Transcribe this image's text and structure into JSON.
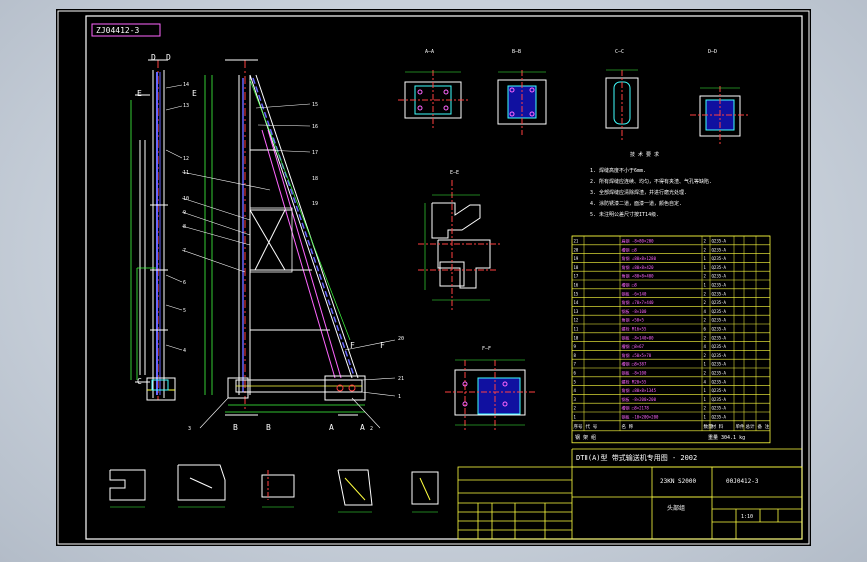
{
  "stamp_code": "ZJ04412-3",
  "colors": {
    "background": "#000000",
    "viewport": "#c9d1db",
    "outline": "#ffffff",
    "centerline": "#ff4040",
    "dimension": "#40ff40",
    "hidden": "#6666ff",
    "highlight": "#ff66ff",
    "table": "#ffff40",
    "cyan": "#40ffff"
  },
  "leader_labels": [
    "14",
    "13",
    "12",
    "11",
    "10",
    "9",
    "8",
    "7",
    "6",
    "5",
    "4",
    "15",
    "16",
    "17",
    "18",
    "19",
    "20",
    "21",
    "3",
    "2",
    "1"
  ],
  "section_letters": [
    "D",
    "E",
    "E",
    "C",
    "D",
    "B",
    "B",
    "A",
    "A",
    "F",
    "F"
  ],
  "notes": {
    "title": "技 术 要 求",
    "lines": [
      "1. 焊缝高度不小于6mm.",
      "2. 所有焊缝应连续、均匀，不得有夹渣、气孔等缺陷.",
      "3. 全部焊缝应清除焊渣，并进行磨光处理.",
      "4. 涂防锈漆二道，面漆一道，颜色自定.",
      "5. 未注明公差尺寸按IT14级."
    ]
  },
  "parts_table": {
    "header": [
      "序号",
      "代 号",
      "名 称",
      "数量",
      "材 料",
      "单件",
      "总计",
      "备 注"
    ],
    "rows": [
      [
        "21",
        "",
        "扁钢 -8×80×200",
        "2",
        "Q235-A",
        "",
        "",
        ""
      ],
      [
        "20",
        "",
        "槽钢 □8",
        "2",
        "Q235-A",
        "",
        "",
        ""
      ],
      [
        "19",
        "",
        "角钢 ∠80×8×1280",
        "1",
        "Q235-A",
        "",
        "",
        ""
      ],
      [
        "18",
        "",
        "角钢 ∠80×8×420",
        "1",
        "Q235-A",
        "",
        "",
        ""
      ],
      [
        "17",
        "",
        "角钢 ∠80×8×400",
        "2",
        "Q235-A",
        "",
        "",
        ""
      ],
      [
        "16",
        "",
        "槽钢 □8",
        "1",
        "Q235-A",
        "",
        "",
        ""
      ],
      [
        "15",
        "",
        "钢板 -6×140",
        "2",
        "Q235-A",
        "",
        "",
        ""
      ],
      [
        "14",
        "",
        "角钢 ∠70×7×440",
        "2",
        "Q235-A",
        "",
        "",
        ""
      ],
      [
        "13",
        "",
        "钢板 -8×100",
        "4",
        "Q235-A",
        "",
        "",
        ""
      ],
      [
        "12",
        "",
        "角钢 ∠50×5",
        "2",
        "Q235-A",
        "",
        "",
        ""
      ],
      [
        "11",
        "",
        "螺栓 M16×55",
        "6",
        "Q235-A",
        "",
        "",
        ""
      ],
      [
        "10",
        "",
        "钢板 -8×140×80",
        "2",
        "Q235-A",
        "",
        "",
        ""
      ],
      [
        "9",
        "",
        "槽钢 □8×67",
        "4",
        "Q235-A",
        "",
        "",
        ""
      ],
      [
        "8",
        "",
        "角钢 ∠50×5×70",
        "2",
        "Q235-A",
        "",
        "",
        ""
      ],
      [
        "7",
        "",
        "槽钢 □8×387",
        "1",
        "Q235-A",
        "",
        "",
        ""
      ],
      [
        "6",
        "",
        "钢板 -8×100",
        "2",
        "Q235-A",
        "",
        "",
        ""
      ],
      [
        "5",
        "",
        "螺栓 M20×55",
        "4",
        "Q235-A",
        "",
        "",
        ""
      ],
      [
        "4",
        "",
        "角钢 ∠80×8×1345",
        "1",
        "Q235-A",
        "",
        "",
        ""
      ],
      [
        "3",
        "",
        "钢板 -8×200×200",
        "1",
        "Q235-A",
        "",
        "",
        ""
      ],
      [
        "2",
        "",
        "槽钢 □8×2178",
        "2",
        "Q235-A",
        "",
        "",
        ""
      ],
      [
        "1",
        "",
        "钢板 -10×200×200",
        "1",
        "Q235-A",
        "",
        "",
        ""
      ]
    ],
    "footer_mass": "重量 304.1 kg",
    "footer_left": "钢 架 组"
  },
  "title_block": {
    "project": "DTⅡ(A)型 带式输送机专用图 - 2002",
    "model": "23KN S2000",
    "drawing_no": "00J0412-3",
    "part_name": "头部组",
    "scale": "1:10"
  }
}
